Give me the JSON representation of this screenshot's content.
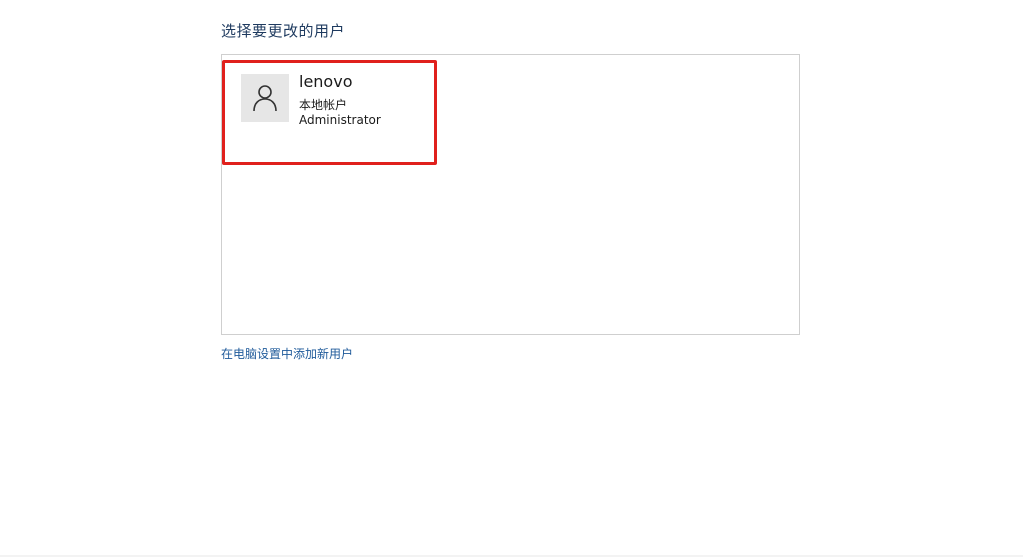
{
  "page": {
    "title": "选择要更改的用户"
  },
  "users": [
    {
      "name": "lenovo",
      "account_type": "本地帐户",
      "role": "Administrator",
      "avatar_icon": "user-outline-icon"
    }
  ],
  "links": {
    "add_user": "在电脑设置中添加新用户"
  },
  "colors": {
    "title": "#1e3a5f",
    "link": "#1e5a9a",
    "highlight_border": "#e0201c",
    "avatar_bg": "#e6e6e6"
  }
}
